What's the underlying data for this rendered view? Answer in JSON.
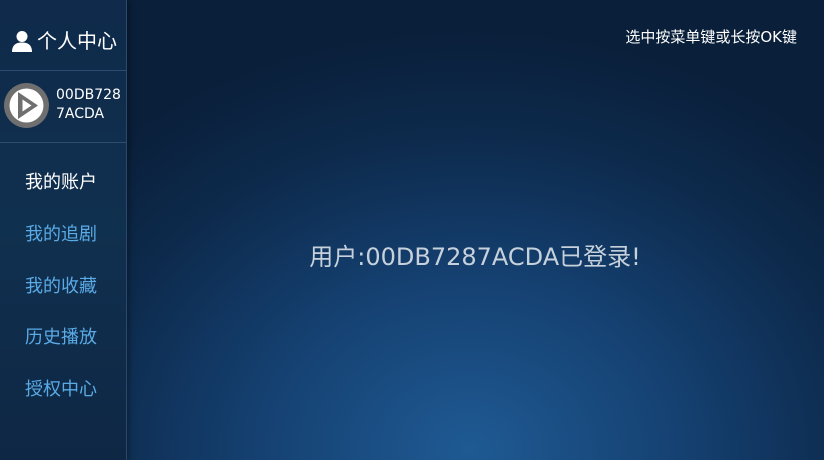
{
  "sidebar": {
    "title": "个人中心",
    "icon": "user-icon",
    "account": {
      "avatar_icon": "play-logo-icon",
      "id": "00DB7287ACDA"
    },
    "items": [
      {
        "label": "我的账户",
        "active": true
      },
      {
        "label": "我的追剧",
        "active": false
      },
      {
        "label": "我的收藏",
        "active": false
      },
      {
        "label": "历史播放",
        "active": false
      },
      {
        "label": "授权中心",
        "active": false
      }
    ]
  },
  "header": {
    "hint": "选中按菜单键或长按OK键"
  },
  "main": {
    "status_message": "用户:00DB7287ACDA已登录!"
  },
  "colors": {
    "background": "#154172",
    "sidebar": "#10304f",
    "menu_item": "#5aaae6",
    "menu_item_active": "#ffffff",
    "status_text": "#c7d1dc"
  }
}
